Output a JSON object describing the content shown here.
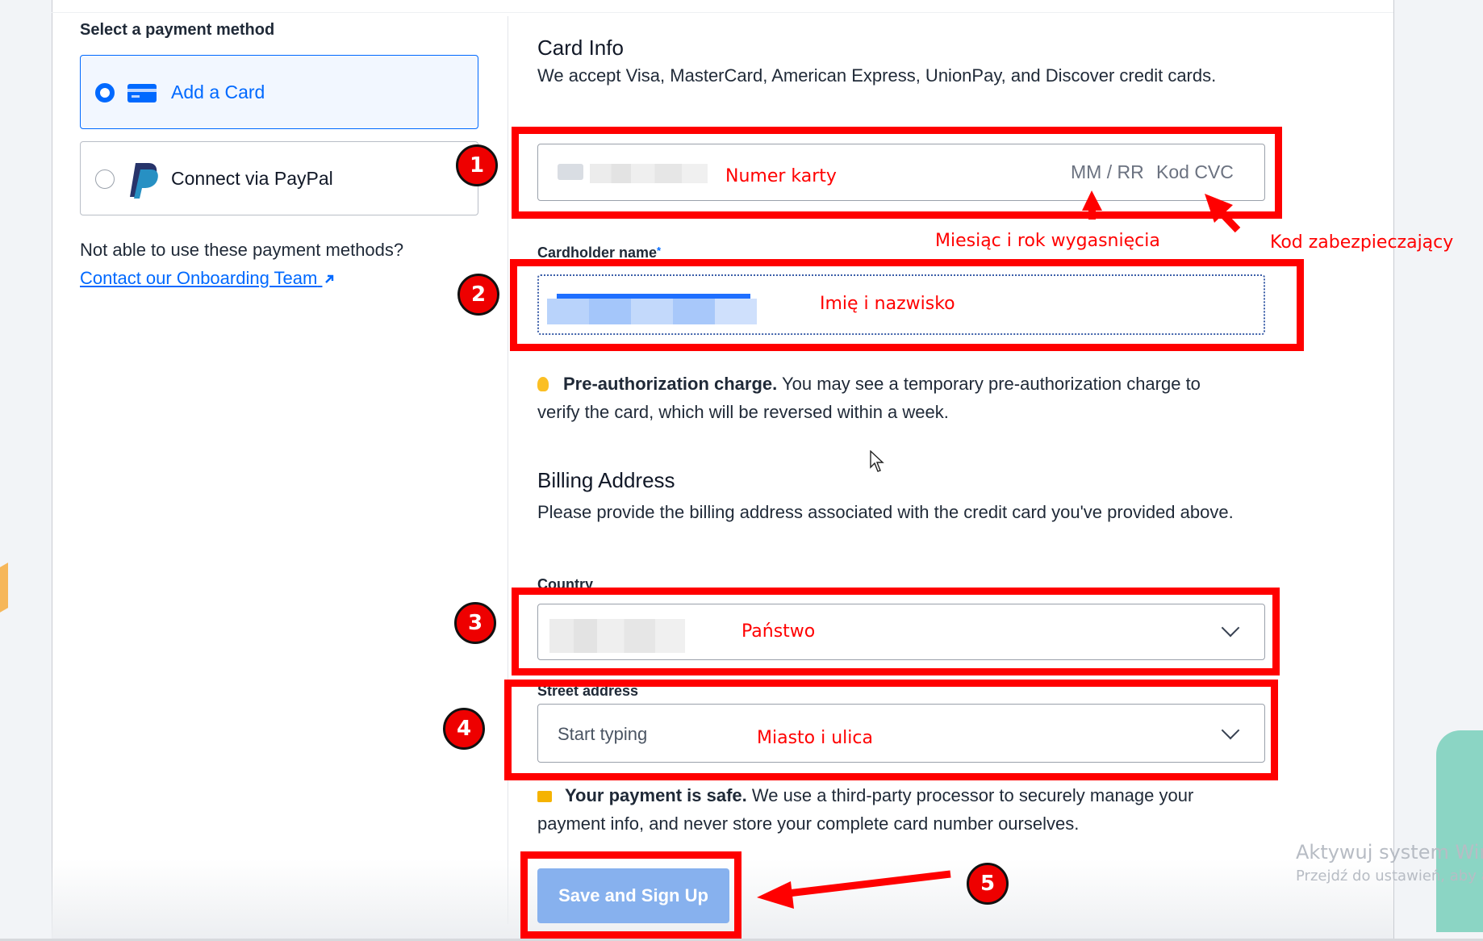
{
  "payment_method": {
    "heading": "Select a payment method",
    "options": [
      {
        "label": "Add a Card",
        "selected": true,
        "icon": "credit-card-icon"
      },
      {
        "label": "Connect via PayPal",
        "selected": false,
        "icon": "paypal-icon"
      }
    ],
    "help_text": "Not able to use these payment methods?",
    "help_link": "Contact our Onboarding Team"
  },
  "card_info": {
    "title": "Card Info",
    "subtitle": "We accept Visa, MasterCard, American Express, UnionPay, and Discover credit cards.",
    "card_number_placeholder_expiry": "MM / RR",
    "card_number_placeholder_cvc": "Kod CVC",
    "cardholder_label": "Cardholder name",
    "required_mark": "*",
    "preauth_title": "Pre-authorization charge.",
    "preauth_text": " You may see a temporary pre-authorization charge to verify the card, which will be reversed within a week."
  },
  "billing": {
    "title": "Billing Address",
    "subtitle": "Please provide the billing address associated with the credit card you've provided above.",
    "country_label": "Country",
    "street_label": "Street address",
    "street_placeholder": "Start typing",
    "safe_title": "Your payment is safe.",
    "safe_text": " We use a third-party processor to securely manage your payment info, and never store your complete card number ourselves.",
    "submit_label": "Save and Sign Up"
  },
  "annotations": {
    "badges": [
      "1",
      "2",
      "3",
      "4",
      "5"
    ],
    "card_number": "Numer karty",
    "expiry": "Miesiąc i rok wygasnięcia",
    "security_code": "Kod zabezpieczający",
    "name": "Imię i nazwisko",
    "country": "Państwo",
    "street": "Miasto i ulica"
  },
  "watermark": {
    "line1": "Aktywuj system Win",
    "line2": "Przejdź do ustawień, aby a"
  },
  "colors": {
    "accent": "#0069ff",
    "annotation_red": "#ff0000",
    "button_disabled": "#87b1ee"
  }
}
